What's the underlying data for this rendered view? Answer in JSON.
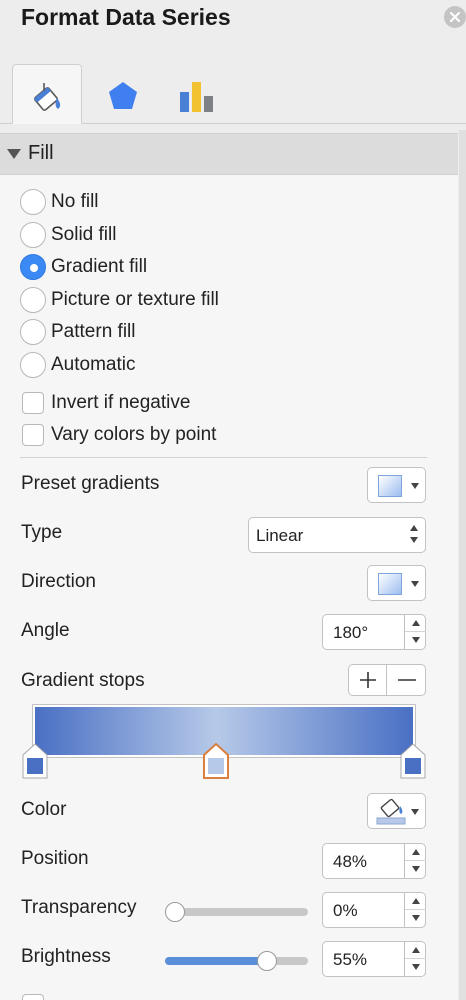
{
  "window": {
    "title": "Format Data Series"
  },
  "tabs": [
    {
      "name": "Fill & Line",
      "icon": "paint-bucket-icon",
      "active": true
    },
    {
      "name": "Effects",
      "icon": "pentagon-icon",
      "active": false
    },
    {
      "name": "Series Options",
      "icon": "bar-chart-icon",
      "active": false
    }
  ],
  "fill": {
    "section_label": "Fill",
    "options": [
      {
        "label": "No fill",
        "selected": false
      },
      {
        "label": "Solid fill",
        "selected": false
      },
      {
        "label": "Gradient fill",
        "selected": true
      },
      {
        "label": "Picture or texture fill",
        "selected": false
      },
      {
        "label": "Pattern fill",
        "selected": false
      },
      {
        "label": "Automatic",
        "selected": false
      }
    ],
    "checkboxes": [
      {
        "label": "Invert if negative",
        "checked": false
      },
      {
        "label": "Vary colors by point",
        "checked": false
      }
    ]
  },
  "gradient": {
    "preset_label": "Preset gradients",
    "type_label": "Type",
    "type_value": "Linear",
    "direction_label": "Direction",
    "angle_label": "Angle",
    "angle_value": "180°",
    "stops_label": "Gradient stops",
    "colors": {
      "end": "#4a70c4",
      "mid": "#b6c9e8"
    },
    "stops": [
      {
        "position": 0,
        "color": "#4a70c4",
        "selected": false
      },
      {
        "position": 0.48,
        "color": "#b6c9e8",
        "selected": true
      },
      {
        "position": 1,
        "color": "#4a70c4",
        "selected": false
      }
    ],
    "color_label": "Color",
    "position_label": "Position",
    "position_value": "48%",
    "transparency_label": "Transparency",
    "transparency_value": "0%",
    "transparency_level": 0,
    "brightness_label": "Brightness",
    "brightness_value": "55%",
    "brightness_level": 0.75
  },
  "colors": {
    "accent": "#3b89f4",
    "selected_stop_border": "#d9803f"
  }
}
